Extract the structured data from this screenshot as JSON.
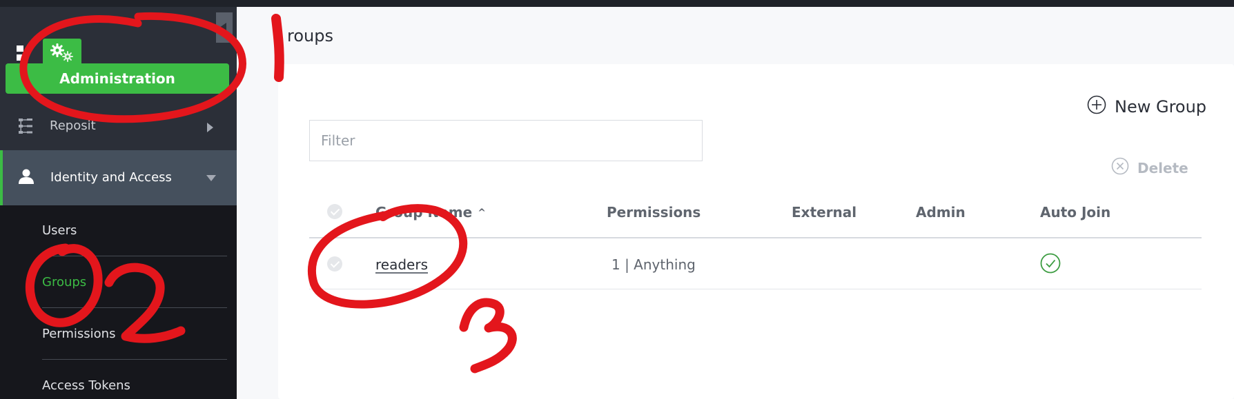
{
  "sidebar": {
    "admin_label": "Administration",
    "repositories_label": "Reposit",
    "identity_label": "Identity and Access",
    "items": [
      {
        "label": "Users"
      },
      {
        "label": "Groups"
      },
      {
        "label": "Permissions"
      },
      {
        "label": "Access Tokens"
      }
    ]
  },
  "page": {
    "title": "roups"
  },
  "toolbar": {
    "new_group_label": "New Group",
    "delete_label": "Delete"
  },
  "filter": {
    "placeholder": "Filter",
    "value": ""
  },
  "table": {
    "columns": [
      "Group Name",
      "Permissions",
      "External",
      "Admin",
      "Auto Join"
    ],
    "rows": [
      {
        "name": "readers",
        "permissions": "1 | Anything",
        "external": "",
        "admin": "",
        "auto_join": true
      }
    ]
  },
  "annotations": {
    "mark_1": "1",
    "mark_2": "2",
    "mark_3": "3"
  },
  "colors": {
    "accent": "#3cbc45",
    "annotation": "#e3161c",
    "sidebar_dark": "#16171c",
    "sidebar_mid": "#2b2f38",
    "sidebar_active": "#45505d"
  }
}
